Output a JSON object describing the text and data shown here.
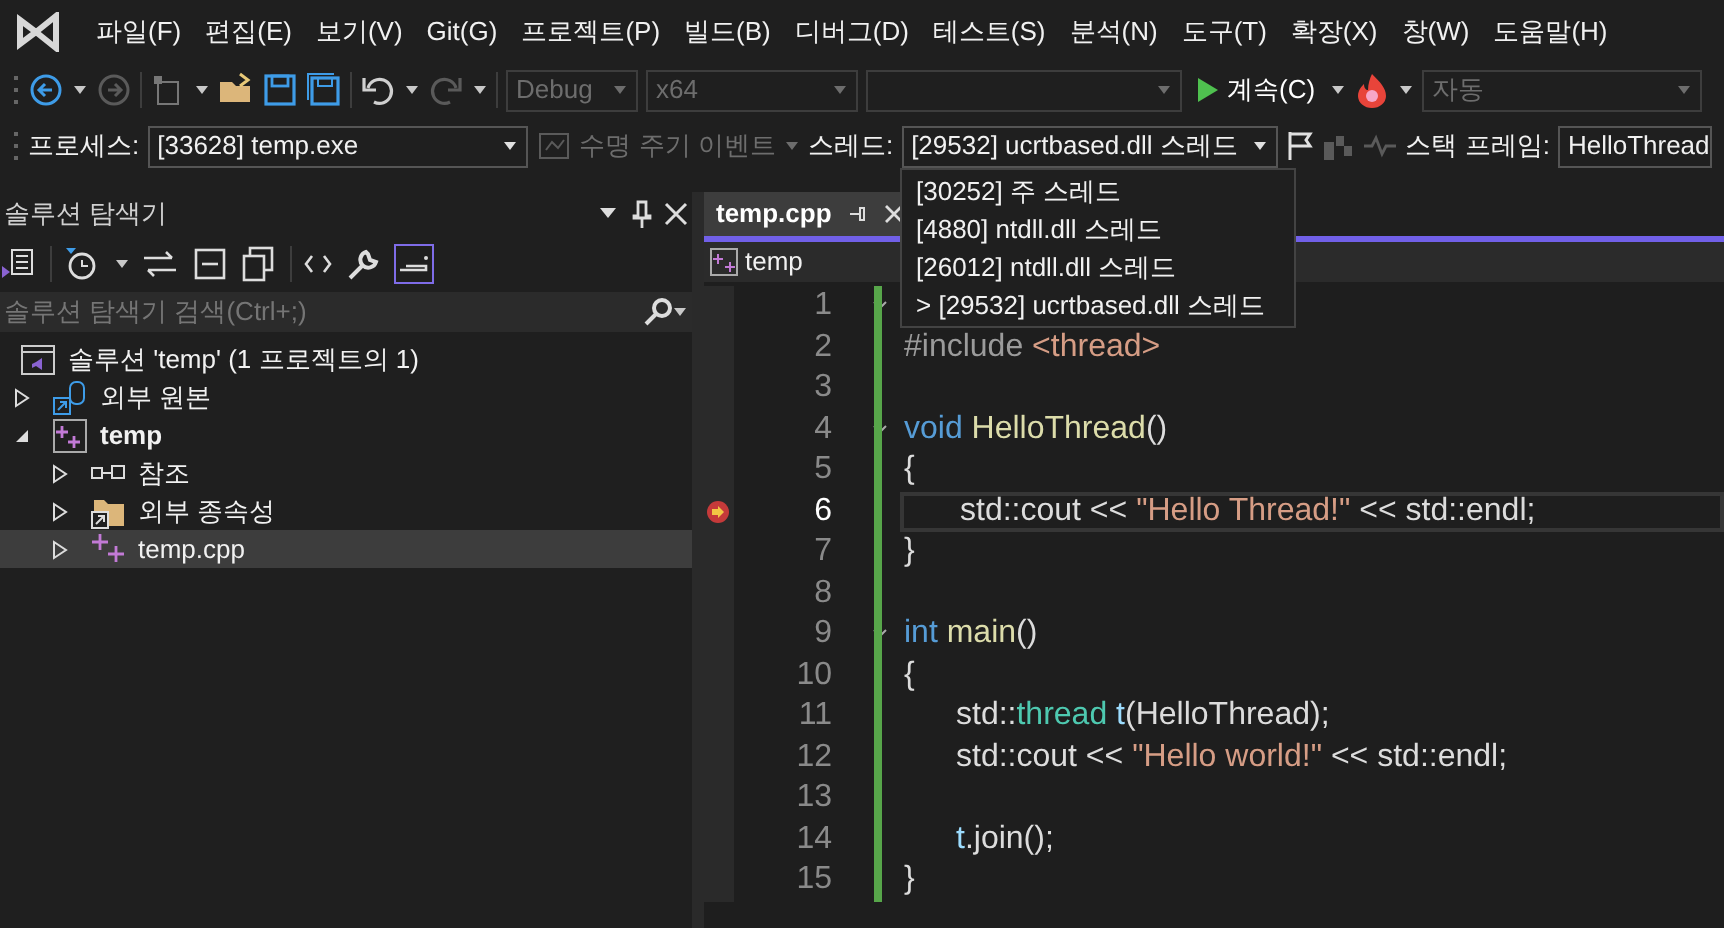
{
  "menu": [
    "파일(F)",
    "편집(E)",
    "보기(V)",
    "Git(G)",
    "프로젝트(P)",
    "빌드(B)",
    "디버그(D)",
    "테스트(S)",
    "분석(N)",
    "도구(T)",
    "확장(X)",
    "창(W)",
    "도움말(H)"
  ],
  "toolbar": {
    "configuration": "Debug",
    "platform": "x64",
    "continue": "계속(C)",
    "auto": "자동"
  },
  "debug_location": {
    "process_label": "프로세스:",
    "process": "[33628] temp.exe",
    "lifecycle": "수명 주기 이벤트",
    "thread_label": "스레드:",
    "thread": "[29532] ucrtbased.dll 스레드",
    "stack_label": "스택 프레임:",
    "stack_frame": "HelloThread"
  },
  "thread_dropdown": [
    {
      "label": "[30252] 주 스레드"
    },
    {
      "label": "[4880] ntdll.dll 스레드"
    },
    {
      "label": "[26012] ntdll.dll 스레드"
    },
    {
      "marker": ">",
      "label": "[29532] ucrtbased.dll 스레드"
    }
  ],
  "solution_explorer": {
    "title": "솔루션 탐색기",
    "search_placeholder": "솔루션 탐색기 검색(Ctrl+;)",
    "tree": [
      {
        "kind": "solution",
        "label": "솔루션 'temp' (1 프로젝트의 1)",
        "selected": false,
        "children": [
          {
            "kind": "external",
            "label": "외부 원본",
            "expanded": false,
            "selected": false
          },
          {
            "kind": "project",
            "label": "temp",
            "expanded": true,
            "selected": false,
            "children": [
              {
                "kind": "references",
                "label": "참조",
                "expanded": false,
                "selected": false
              },
              {
                "kind": "dependencies",
                "label": "외부 종속성",
                "expanded": false,
                "selected": false
              },
              {
                "kind": "file",
                "label": "temp.cpp",
                "expanded": false,
                "selected": true
              }
            ]
          }
        ]
      }
    ]
  },
  "editor": {
    "tab": "temp.cpp",
    "scope": "temp",
    "lines": [
      {
        "number": "1",
        "fold": true
      },
      {
        "number": "2",
        "tokens": [
          {
            "kind": "pre",
            "text": "#include "
          },
          {
            "kind": "str",
            "text": "<thread>"
          }
        ]
      },
      {
        "number": "3"
      },
      {
        "number": "4",
        "fold": true,
        "tokens": [
          {
            "kind": "kw",
            "text": "void "
          },
          {
            "kind": "fn",
            "text": "HelloThread"
          },
          {
            "kind": "plain",
            "text": "()"
          }
        ]
      },
      {
        "number": "5",
        "tokens": [
          {
            "kind": "plain",
            "text": "{"
          }
        ]
      },
      {
        "number": "6",
        "current": true,
        "indented": true,
        "tokens": [
          {
            "kind": "plain",
            "text": "std::cout << "
          },
          {
            "kind": "str",
            "text": "\"Hello Thread!\""
          },
          {
            "kind": "plain",
            "text": " << std::endl;"
          }
        ]
      },
      {
        "number": "7",
        "tokens": [
          {
            "kind": "plain",
            "text": "}"
          }
        ]
      },
      {
        "number": "8"
      },
      {
        "number": "9",
        "fold": true,
        "tokens": [
          {
            "kind": "kw",
            "text": "int "
          },
          {
            "kind": "fn",
            "text": "main"
          },
          {
            "kind": "plain",
            "text": "()"
          }
        ]
      },
      {
        "number": "10",
        "tokens": [
          {
            "kind": "plain",
            "text": "{"
          }
        ]
      },
      {
        "number": "11",
        "indented": true,
        "tokens": [
          {
            "kind": "plain",
            "text": "std::"
          },
          {
            "kind": "type",
            "text": "thread"
          },
          {
            "kind": "var",
            "text": " t"
          },
          {
            "kind": "plain",
            "text": "(HelloThread);"
          }
        ]
      },
      {
        "number": "12",
        "indented": true,
        "tokens": [
          {
            "kind": "plain",
            "text": "std::cout << "
          },
          {
            "kind": "str",
            "text": "\"Hello world!\""
          },
          {
            "kind": "plain",
            "text": " << std::endl;"
          }
        ]
      },
      {
        "number": "13"
      },
      {
        "number": "14",
        "indented": true,
        "tokens": [
          {
            "kind": "var",
            "text": "t"
          },
          {
            "kind": "plain",
            "text": ".join();"
          }
        ]
      },
      {
        "number": "15",
        "tokens": [
          {
            "kind": "plain",
            "text": "}"
          }
        ]
      }
    ]
  }
}
